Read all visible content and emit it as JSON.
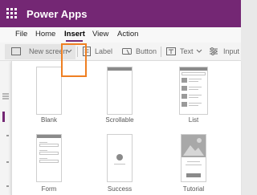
{
  "app": {
    "title": "Power Apps"
  },
  "menu": {
    "items": [
      {
        "label": "File"
      },
      {
        "label": "Home"
      },
      {
        "label": "Insert",
        "active": true
      },
      {
        "label": "View"
      },
      {
        "label": "Action"
      }
    ]
  },
  "toolbar": {
    "new_screen_label": "New screen",
    "label_label": "Label",
    "button_label": "Button",
    "text_label": "Text",
    "input_label": "Input"
  },
  "layouts": [
    {
      "label": "Blank"
    },
    {
      "label": "Scrollable"
    },
    {
      "label": "List"
    },
    {
      "label": "Form"
    },
    {
      "label": "Success"
    },
    {
      "label": "Tutorial"
    }
  ],
  "colors": {
    "brand": "#742774",
    "highlight": "#ef7f22"
  }
}
